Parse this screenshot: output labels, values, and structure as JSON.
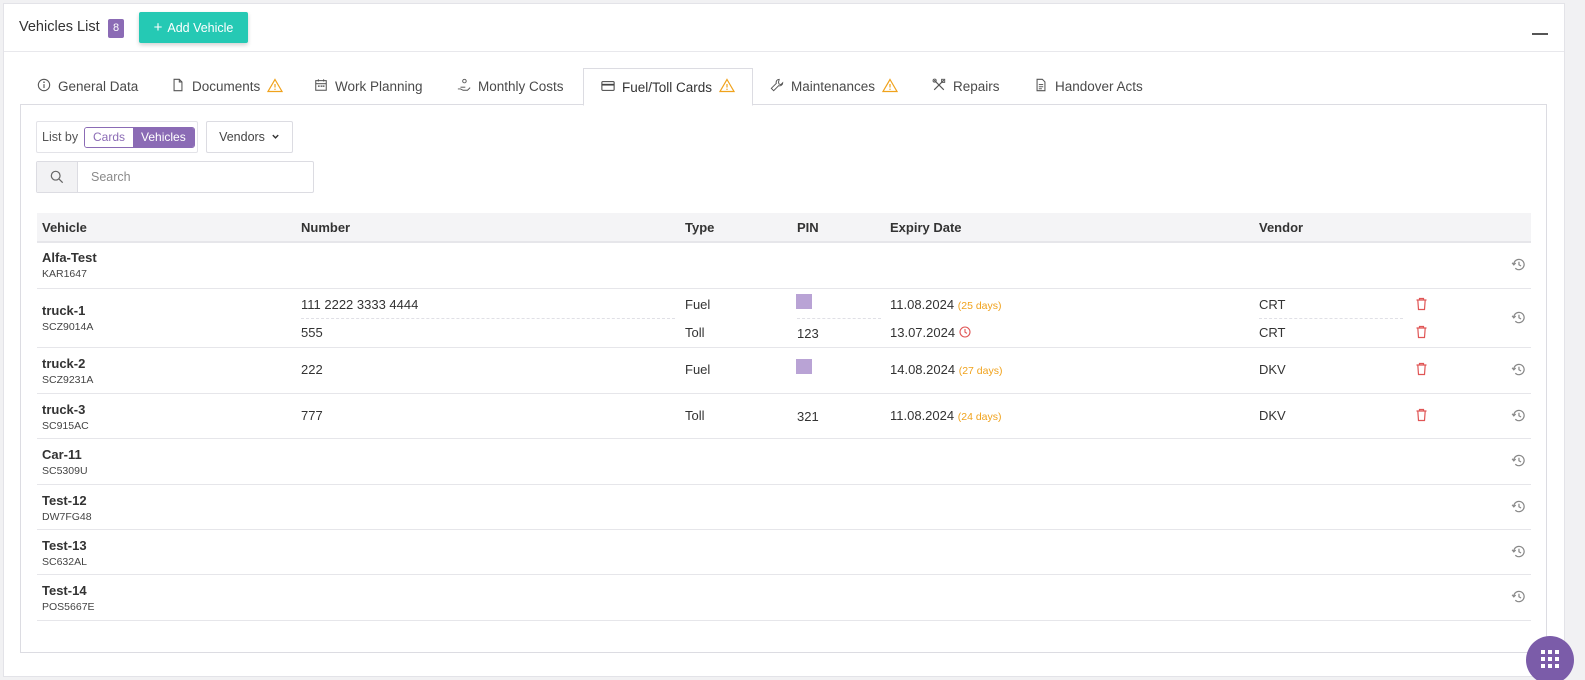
{
  "header": {
    "title": "Vehicles List",
    "count": "8",
    "add_label": "Add Vehicle"
  },
  "tabs": [
    {
      "label": "General Data"
    },
    {
      "label": "Documents"
    },
    {
      "label": "Work Planning"
    },
    {
      "label": "Monthly Costs"
    },
    {
      "label": "Fuel/Toll Cards",
      "active": true
    },
    {
      "label": "Maintenances"
    },
    {
      "label": "Repairs"
    },
    {
      "label": "Handover Acts"
    }
  ],
  "filters": {
    "list_by_label": "List by",
    "options": [
      "Cards",
      "Vehicles"
    ],
    "selected": "Vehicles",
    "vendors_label": "Vendors",
    "search_placeholder": "Search"
  },
  "table": {
    "columns": [
      "Vehicle",
      "Number",
      "Type",
      "PIN",
      "Expiry Date",
      "Vendor"
    ],
    "rows": [
      {
        "name": "Alfa-Test",
        "plate": "KAR1647",
        "cards": []
      },
      {
        "name": "truck-1",
        "plate": "SCZ9014A",
        "cards": [
          {
            "number": "111 2222 3333 4444",
            "type": "Fuel",
            "pin": "",
            "expiry": "11.08.2024",
            "days": "(25 days)",
            "vendor": "CRT"
          },
          {
            "number": "555",
            "type": "Toll",
            "pin": "123",
            "expiry": "13.07.2024",
            "days": "",
            "vendor": "CRT"
          }
        ]
      },
      {
        "name": "truck-2",
        "plate": "SCZ9231A",
        "cards": [
          {
            "number": "222",
            "type": "Fuel",
            "pin": "",
            "expiry": "14.08.2024",
            "days": "(27 days)",
            "vendor": "DKV"
          }
        ]
      },
      {
        "name": "truck-3",
        "plate": "SC915AC",
        "cards": [
          {
            "number": "777",
            "type": "Toll",
            "pin": "321",
            "expiry": "11.08.2024",
            "days": "(24 days)",
            "vendor": "DKV"
          }
        ]
      },
      {
        "name": "Car-11",
        "plate": "SC5309U",
        "cards": []
      },
      {
        "name": "Test-12",
        "plate": "DW7FG48",
        "cards": []
      },
      {
        "name": "Test-13",
        "plate": "SC632AL",
        "cards": []
      },
      {
        "name": "Test-14",
        "plate": "POS5667E",
        "cards": []
      }
    ]
  },
  "colors": {
    "accent": "#8b6bb5",
    "add_button": "#25c9b4",
    "warning": "#f0a21c",
    "danger": "#e05555"
  },
  "icons": [
    "info-icon",
    "document-icon",
    "calendar-icon",
    "hand-coins-icon",
    "credit-card-icon",
    "wrench-icon",
    "tools-icon",
    "file-icon",
    "warning-icon",
    "search-icon",
    "chevron-down-icon",
    "trash-icon",
    "history-icon",
    "clock-icon",
    "grid-menu-icon"
  ]
}
